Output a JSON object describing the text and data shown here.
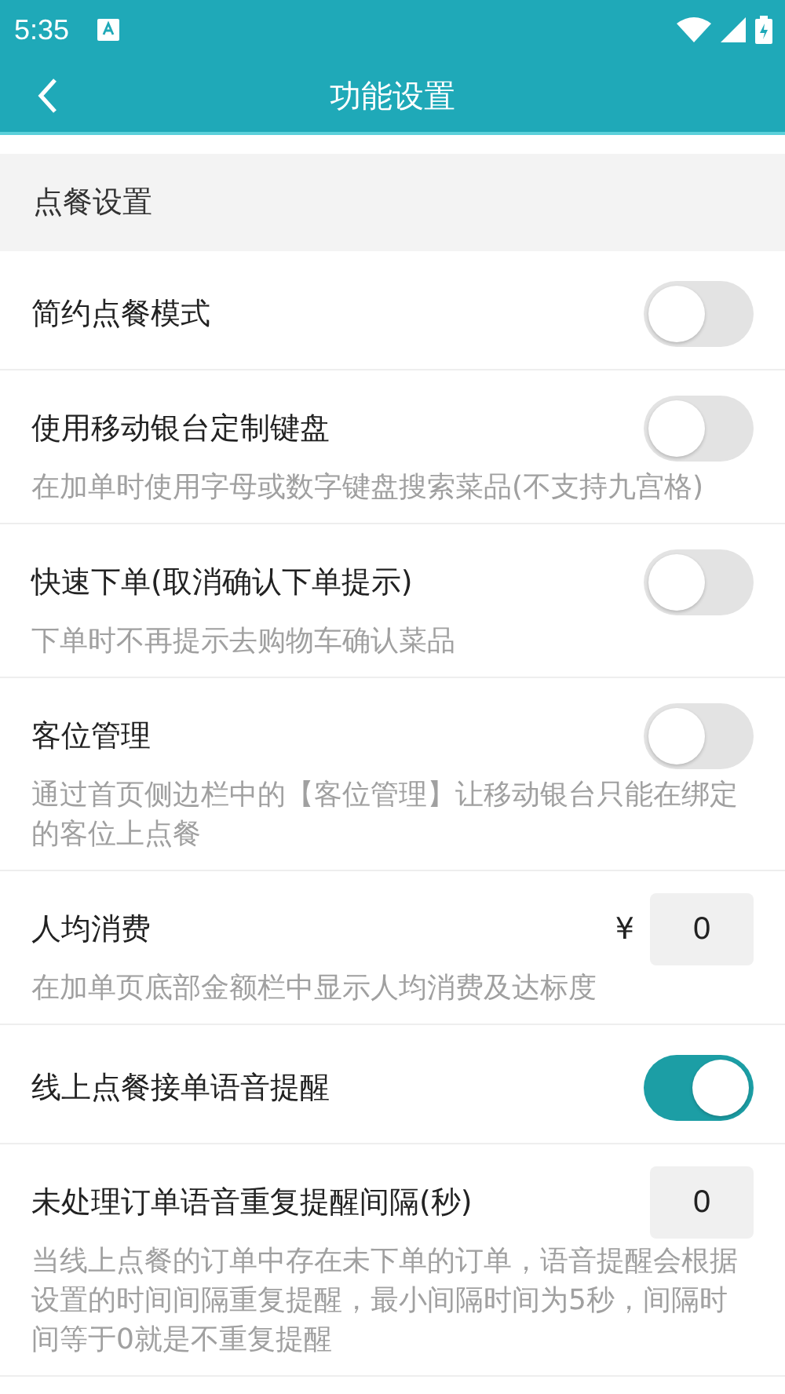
{
  "status_bar": {
    "time": "5:35"
  },
  "header": {
    "title": "功能设置"
  },
  "section": {
    "title": "点餐设置"
  },
  "settings": [
    {
      "kind": "toggle",
      "label": "简约点餐模式",
      "on": false
    },
    {
      "kind": "toggle",
      "label": "使用移动银台定制键盘",
      "on": false,
      "description": "在加单时使用字母或数字键盘搜索菜品(不支持九宫格)"
    },
    {
      "kind": "toggle",
      "label": "快速下单(取消确认下单提示)",
      "on": false,
      "description": "下单时不再提示去购物车确认菜品"
    },
    {
      "kind": "toggle",
      "label": "客位管理",
      "on": false,
      "description": "通过首页侧边栏中的【客位管理】让移动银台只能在绑定的客位上点餐"
    },
    {
      "kind": "amount",
      "label": "人均消费",
      "currency": "¥",
      "value": "0",
      "description": "在加单页底部金额栏中显示人均消费及达标度"
    },
    {
      "kind": "toggle",
      "label": "线上点餐接单语音提醒",
      "on": true
    },
    {
      "kind": "number",
      "label": "未处理订单语音重复提醒间隔(秒)",
      "value": "0",
      "description": "当线上点餐的订单中存在未下单的订单，语音提醒会根据设置的时间间隔重复提醒，最小间隔时间为5秒，间隔时间等于0就是不重复提醒"
    }
  ]
}
